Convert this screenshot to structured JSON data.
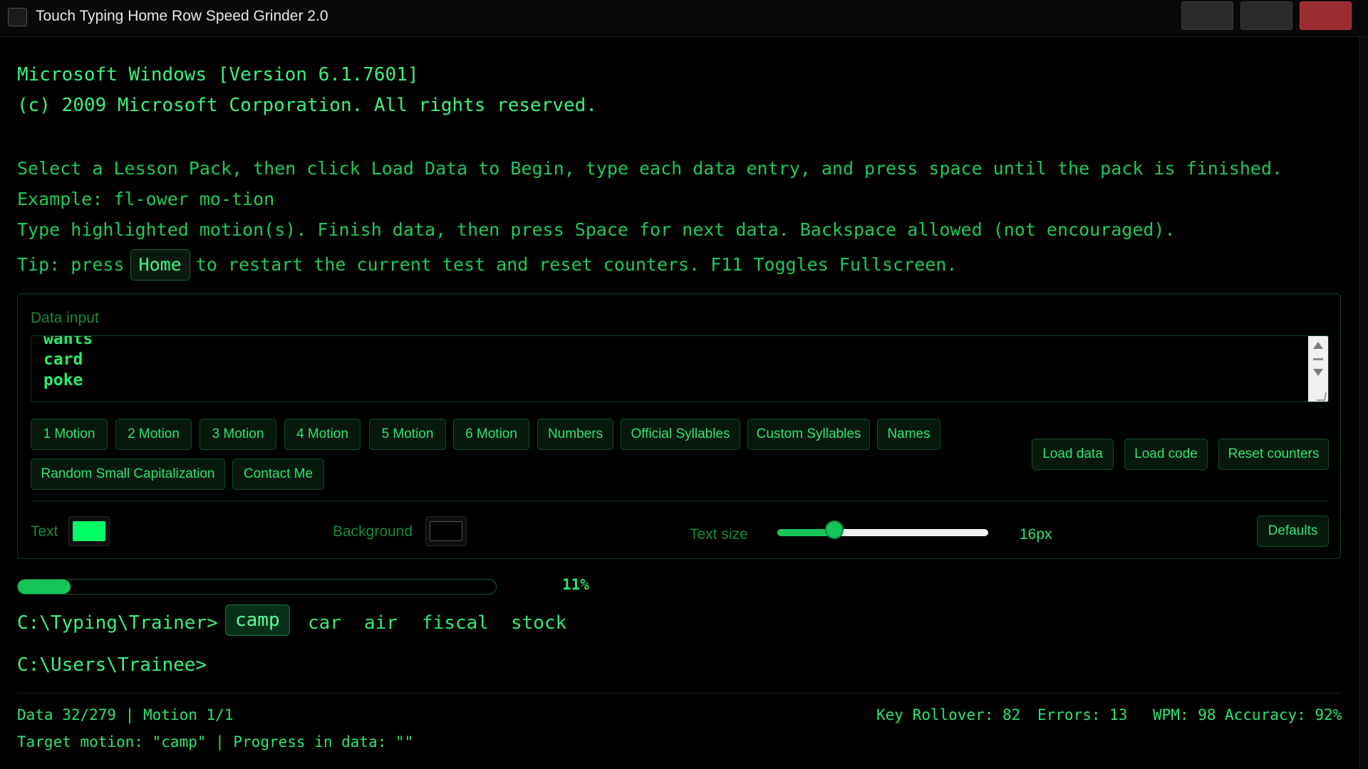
{
  "window": {
    "title": "Touch Typing Home Row Speed Grinder 2.0"
  },
  "console": {
    "header_line1": "Microsoft Windows [Version 6.1.7601]",
    "header_line2": "(c) 2009 Microsoft Corporation. All rights reserved.",
    "instruction": "Select a Lesson Pack, then click Load Data to Begin, type each data entry, and press space until the pack is finished.",
    "example": "Example: fl-ower mo-tion",
    "type_hint": "Type highlighted motion(s). Finish data, then press Space for next data. Backspace allowed (not encouraged).",
    "tip_prefix": "Tip: press",
    "tip_key": "Home",
    "tip_suffix": "to restart the current test and reset counters. F11 Toggles Fullscreen."
  },
  "panel": {
    "data_input_label": "Data input",
    "data_input_lines": [
      "wants",
      "card",
      "poke"
    ],
    "lesson_buttons": [
      "1 Motion",
      "2 Motion",
      "3 Motion",
      "4 Motion",
      "5 Motion",
      "6 Motion",
      "Numbers",
      "Official Syllables",
      "Custom Syllables",
      "Names"
    ],
    "extra_buttons": [
      "Random Small Capitalization",
      "Contact Me"
    ],
    "actions": {
      "load_data": "Load data",
      "load_code": "Load code",
      "reset_counters": "Reset counters"
    },
    "text_color_label": "Text",
    "text_color": "#00ff66",
    "background_color_label": "Background",
    "background_color": "#000000",
    "text_size_label": "Text size",
    "text_size_value": "16px",
    "text_size_fraction": 0.27,
    "defaults_label": "Defaults"
  },
  "progress": {
    "percent_label": "11%",
    "fraction": 0.11
  },
  "prompt": {
    "trainer_prompt": "C:\\Typing\\Trainer>",
    "words": [
      "camp",
      "car",
      "air",
      "fiscal",
      "stock"
    ],
    "current_index": 0,
    "user_prompt": "C:\\Users\\Trainee>"
  },
  "status": {
    "data_counter": "Data 32/279 | Motion 1/1",
    "target_line": "Target motion: \"camp\" | Progress in data: \"\"",
    "key_rollover": "Key Rollover: 82",
    "errors": "Errors: 13",
    "wpm": "WPM: 98",
    "accuracy": "Accuracy: 92%"
  },
  "colors": {
    "accent": "#1fe36a",
    "close_button": "#9b2c31"
  }
}
